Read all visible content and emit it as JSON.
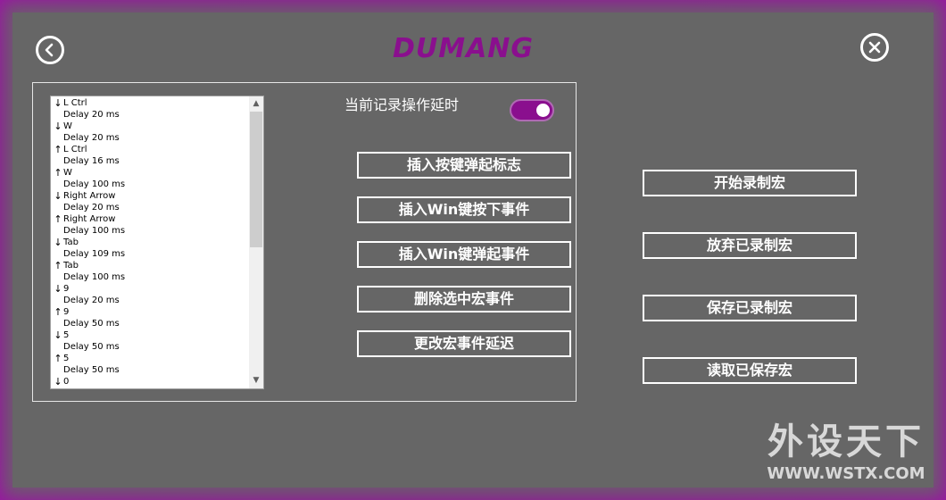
{
  "brand": {
    "logo": "DUMANG",
    "color": "#8a0f8e"
  },
  "header": {
    "back_icon": "back-arrow-icon",
    "close_icon": "close-x-icon"
  },
  "event_list": {
    "items": [
      {
        "arrow": "↓",
        "label": "L Ctrl"
      },
      {
        "arrow": "",
        "label": "Delay 20 ms"
      },
      {
        "arrow": "↓",
        "label": "W"
      },
      {
        "arrow": "",
        "label": "Delay 20 ms"
      },
      {
        "arrow": "↑",
        "label": "L Ctrl"
      },
      {
        "arrow": "",
        "label": "Delay 16 ms"
      },
      {
        "arrow": "↑",
        "label": "W"
      },
      {
        "arrow": "",
        "label": "Delay 100 ms"
      },
      {
        "arrow": "↓",
        "label": "Right Arrow"
      },
      {
        "arrow": "",
        "label": "Delay 20 ms"
      },
      {
        "arrow": "↑",
        "label": "Right Arrow"
      },
      {
        "arrow": "",
        "label": "Delay 100 ms"
      },
      {
        "arrow": "↓",
        "label": "Tab"
      },
      {
        "arrow": "",
        "label": "Delay 109 ms"
      },
      {
        "arrow": "↑",
        "label": "Tab"
      },
      {
        "arrow": "",
        "label": "Delay 100 ms"
      },
      {
        "arrow": "↓",
        "label": "9"
      },
      {
        "arrow": "",
        "label": "Delay 20 ms"
      },
      {
        "arrow": "↑",
        "label": "9"
      },
      {
        "arrow": "",
        "label": "Delay 50 ms"
      },
      {
        "arrow": "↓",
        "label": "5"
      },
      {
        "arrow": "",
        "label": "Delay 50 ms"
      },
      {
        "arrow": "↑",
        "label": "5"
      },
      {
        "arrow": "",
        "label": "Delay 50 ms"
      },
      {
        "arrow": "↓",
        "label": "0"
      }
    ],
    "scroll_up": "▲",
    "scroll_down": "▼"
  },
  "record_delay": {
    "label": "当前记录操作延时",
    "enabled": true
  },
  "edit_buttons": {
    "insert_release_flag": "插入按键弹起标志",
    "insert_win_down": "插入Win键按下事件",
    "insert_win_up": "插入Win键弹起事件",
    "delete_selected": "删除选中宏事件",
    "change_delay": "更改宏事件延迟"
  },
  "macro_buttons": {
    "start_record": "开始录制宏",
    "discard_record": "放弃已录制宏",
    "save_record": "保存已录制宏",
    "load_saved": "读取已保存宏"
  },
  "watermark": {
    "text": "外设天下",
    "url": "WWW.WSTX.COM"
  },
  "colors": {
    "background": "#666666",
    "border": "#8e1a95",
    "accent": "#8a0f8e"
  }
}
